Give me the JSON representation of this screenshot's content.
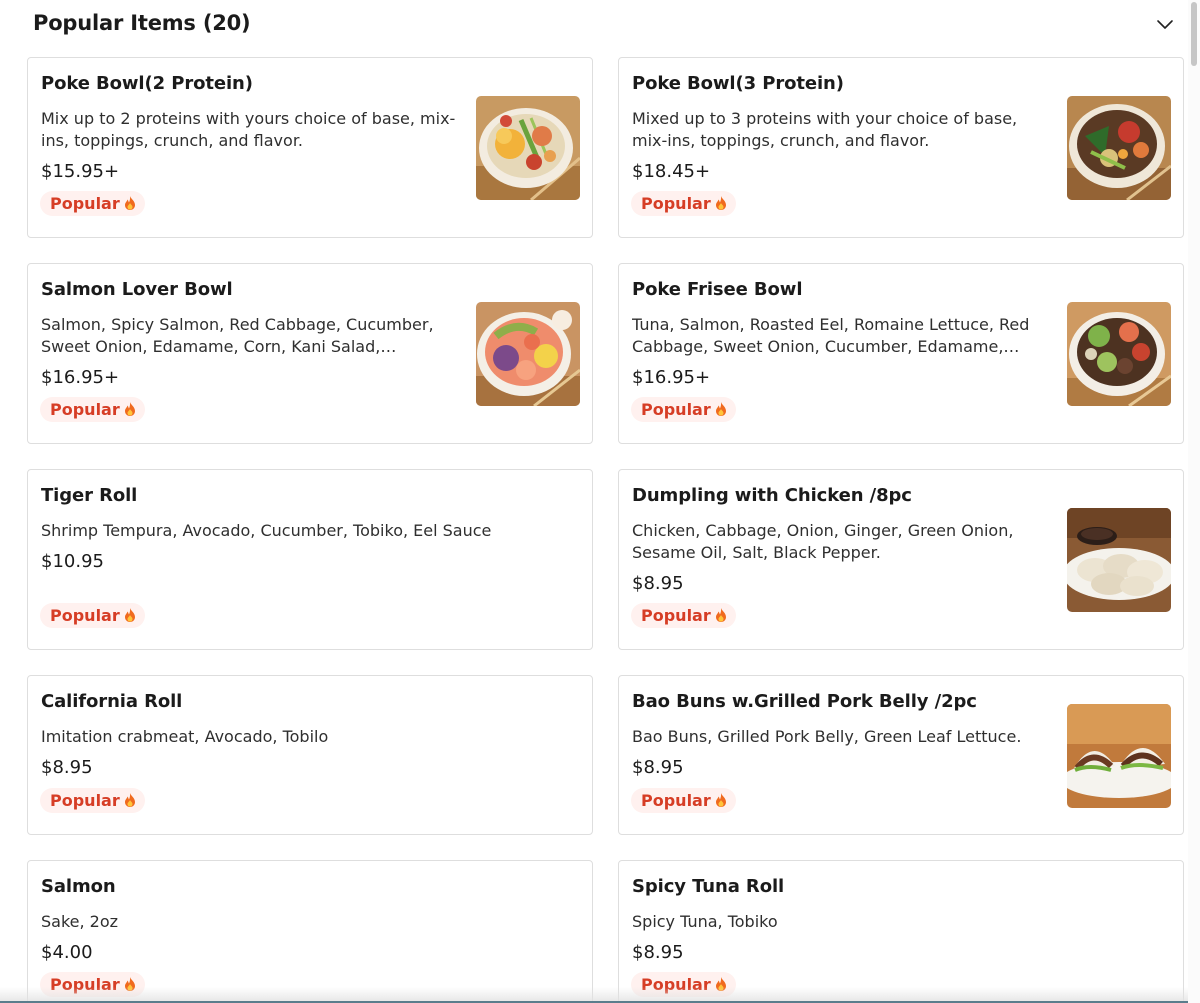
{
  "section": {
    "title": "Popular Items (20)",
    "collapse_icon": "chevron-down-icon"
  },
  "colors": {
    "badge_text": "#d63d25",
    "badge_bg": "#fff1ef",
    "card_border": "#dedede"
  },
  "items": [
    {
      "name": "Poke Bowl(2 Protein)",
      "description": "Mix up to 2 proteins with yours choice of base, mix-ins, toppings, crunch, and flavor.",
      "price": "$15.95+",
      "badge": "Popular",
      "badge_icon": "fire-icon",
      "image": "poke-bowl-two-protein-photo"
    },
    {
      "name": "Poke Bowl(3 Protein)",
      "description": "Mixed up to 3 proteins with your choice of base, mix-ins, toppings, crunch, and flavor.",
      "price": "$18.45+",
      "badge": "Popular",
      "badge_icon": "fire-icon",
      "image": "poke-bowl-three-protein-photo"
    },
    {
      "name": "Salmon Lover Bowl",
      "description": "Salmon, Spicy Salmon, Red Cabbage, Cucumber, Sweet Onion, Edamame, Corn, Kani Salad,…",
      "price": "$16.95+",
      "badge": "Popular",
      "badge_icon": "fire-icon",
      "image": "salmon-lover-bowl-photo"
    },
    {
      "name": "Poke Frisee Bowl",
      "description": "Tuna, Salmon, Roasted Eel, Romaine Lettuce, Red Cabbage, Sweet Onion, Cucumber, Edamame,…",
      "price": "$16.95+",
      "badge": "Popular",
      "badge_icon": "fire-icon",
      "image": "poke-frisee-bowl-photo"
    },
    {
      "name": "Tiger Roll",
      "description": "Shrimp Tempura, Avocado, Cucumber, Tobiko, Eel Sauce",
      "price": "$10.95",
      "badge": "Popular",
      "badge_icon": "fire-icon"
    },
    {
      "name": "Dumpling with Chicken /8pc",
      "description": "Chicken, Cabbage, Onion, Ginger, Green Onion, Sesame Oil, Salt, Black Pepper.",
      "price": "$8.95",
      "badge": "Popular",
      "badge_icon": "fire-icon",
      "image": "chicken-dumplings-photo"
    },
    {
      "name": "California Roll",
      "description": "Imitation crabmeat, Avocado, Tobilo",
      "price": "$8.95",
      "badge": "Popular",
      "badge_icon": "fire-icon"
    },
    {
      "name": "Bao Buns w.Grilled Pork Belly /2pc",
      "description": "Bao Buns, Grilled Pork Belly, Green Leaf Lettuce.",
      "price": "$8.95",
      "badge": "Popular",
      "badge_icon": "fire-icon",
      "image": "bao-buns-photo"
    },
    {
      "name": "Salmon",
      "description": "Sake, 2oz",
      "price": "$4.00",
      "badge": "Popular",
      "badge_icon": "fire-icon"
    },
    {
      "name": "Spicy Tuna Roll",
      "description": "Spicy Tuna, Tobiko",
      "price": "$8.95",
      "badge": "Popular",
      "badge_icon": "fire-icon"
    }
  ]
}
